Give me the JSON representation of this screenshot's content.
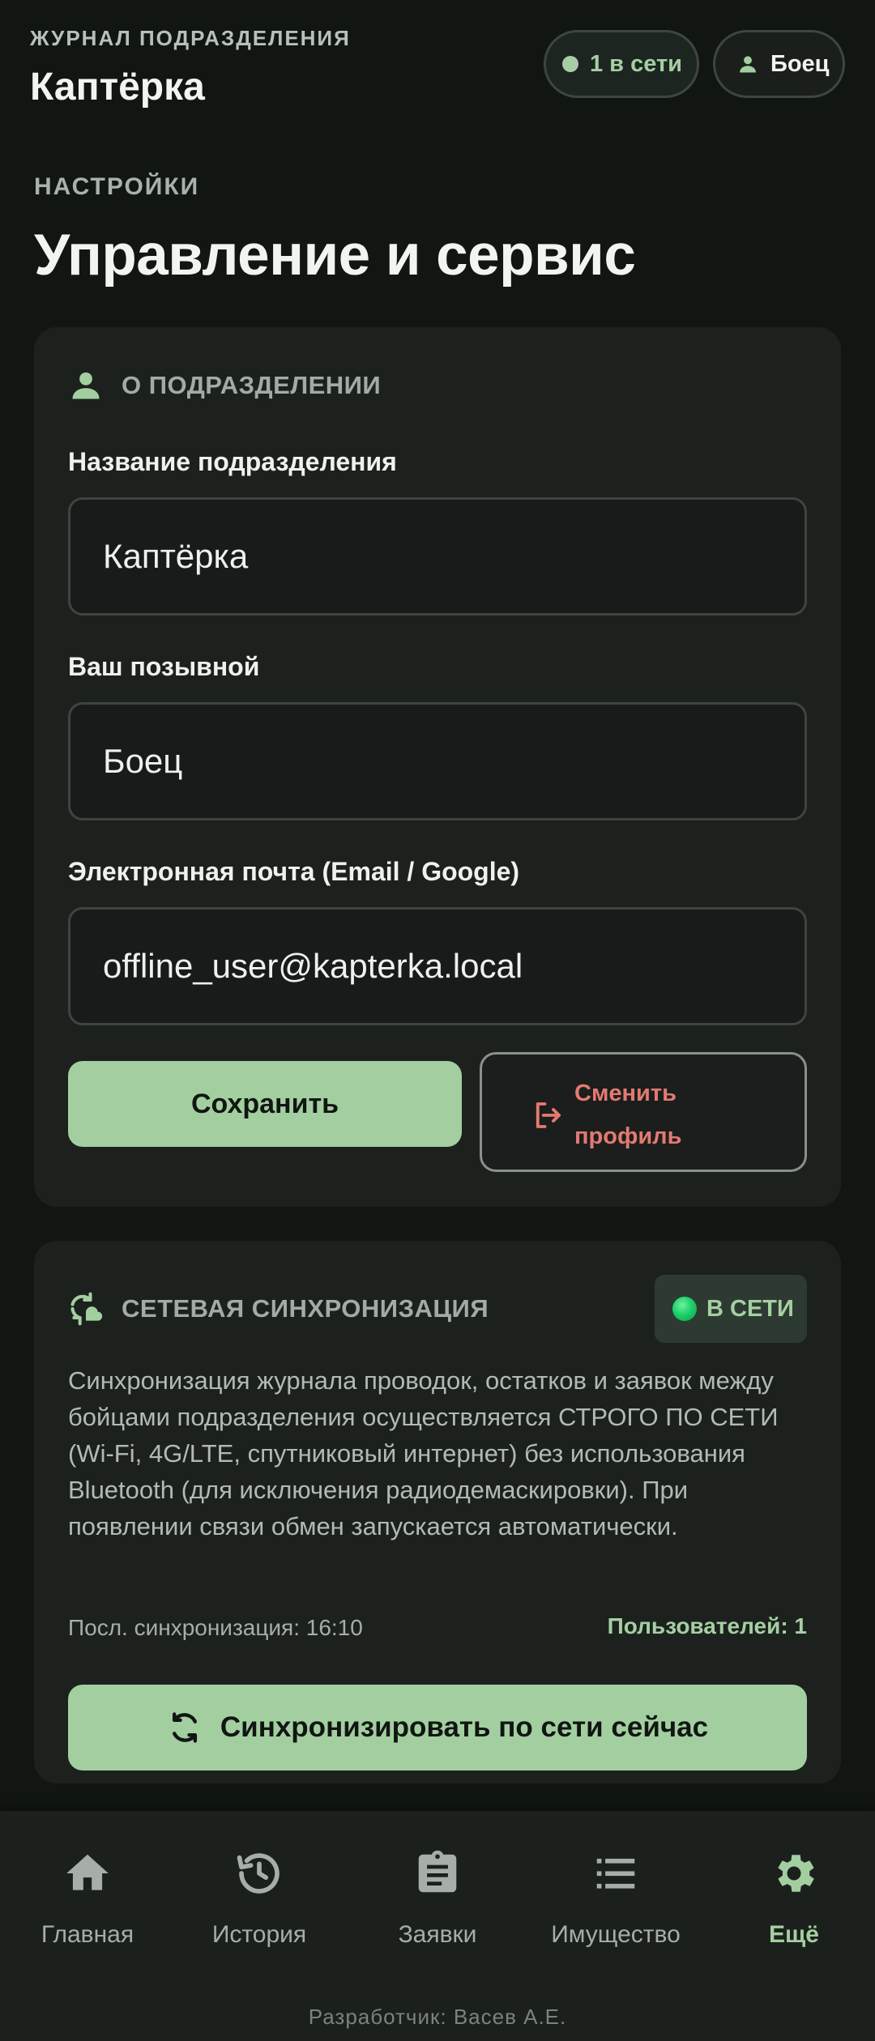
{
  "header": {
    "subtitle": "ЖУРНАЛ ПОДРАЗДЕЛЕНИЯ",
    "title": "Каптёрка",
    "online_chip": "1 в сети",
    "user_chip": "Боец"
  },
  "section": {
    "eyebrow": "НАСТРОЙКИ",
    "title": "Управление и сервис"
  },
  "unit_card": {
    "heading": "О ПОДРАЗДЕЛЕНИИ",
    "unit_name_label": "Название подразделения",
    "unit_name_value": "Каптёрка",
    "callsign_label": "Ваш позывной",
    "callsign_value": "Боец",
    "email_label": "Электронная почта (Email / Google)",
    "email_value": "offline_user@kapterka.local",
    "save_label": "Сохранить",
    "switch_profile_label": "Сменить профиль"
  },
  "sync_card": {
    "heading": "СЕТЕВАЯ СИНХРОНИЗАЦИЯ",
    "status": "В СЕТИ",
    "description": "Синхронизация журнала проводок, остатков и заявок между бойцами подразделения осуществляется СТРОГО ПО СЕТИ (Wi-Fi, 4G/LTE, спутниковый интернет) без использования Bluetooth (для исключения радиодемаскировки). При появлении связи обмен запускается автоматически.",
    "last_sync": "Посл. синхронизация: 16:10",
    "users": "Пользователей: 1",
    "sync_button": "Синхронизировать по сети сейчас"
  },
  "nav": {
    "items": [
      {
        "label": "Главная",
        "icon": "home-icon"
      },
      {
        "label": "История",
        "icon": "history-icon"
      },
      {
        "label": "Заявки",
        "icon": "clipboard-icon"
      },
      {
        "label": "Имущество",
        "icon": "list-icon"
      },
      {
        "label": "Ещё",
        "icon": "gear-icon"
      }
    ],
    "active_index": 4
  },
  "footer": {
    "credit": "Разработчик: Васев А.Е."
  },
  "colors": {
    "background": "#111613",
    "card": "#1d211e",
    "accent": "#a3cfa0",
    "danger": "#e37a72",
    "online_led": "#1bd16a"
  }
}
